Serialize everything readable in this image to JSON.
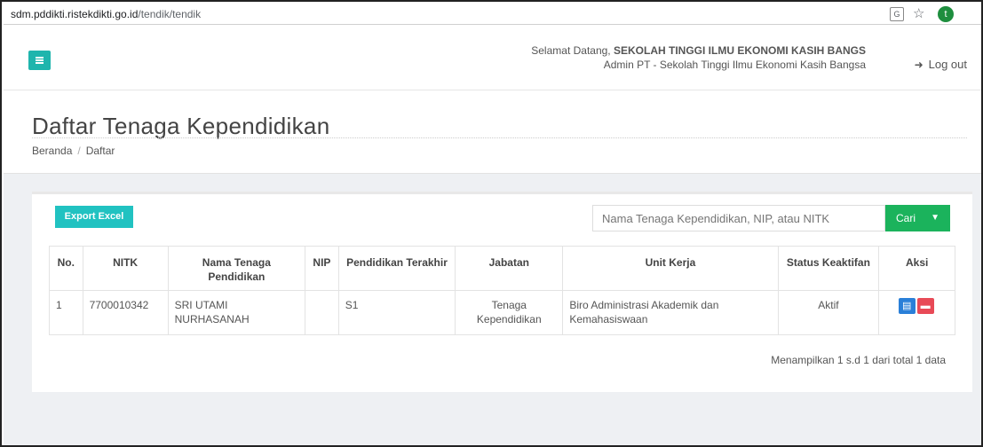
{
  "browser": {
    "url_host": "sdm.pddikti.ristekdikti.go.id",
    "url_path": "/tendik/tendik",
    "profile_initial": "t"
  },
  "header": {
    "welcome_prefix": "Selamat Datang,",
    "institution": "SEKOLAH TINGGI ILMU EKONOMI KASIH BANGS",
    "role": "Admin PT - Sekolah Tinggi Ilmu Ekonomi Kasih Bangsa",
    "logout_label": "Log out"
  },
  "page": {
    "title": "Daftar Tenaga Kependidikan",
    "breadcrumb": [
      "Beranda",
      "Daftar"
    ]
  },
  "toolbar": {
    "export_label": "Export Excel",
    "search_placeholder": "Nama Tenaga Kependidikan, NIP, atau NITK",
    "search_label": "Cari"
  },
  "table": {
    "headers": [
      "No.",
      "NITK",
      "Nama Tenaga Pendidikan",
      "NIP",
      "Pendidikan Terakhir",
      "Jabatan",
      "Unit Kerja",
      "Status Keaktifan",
      "Aksi"
    ],
    "rows": [
      {
        "no": "1",
        "nitk": "7700010342",
        "nama": "SRI UTAMI NURHASANAH",
        "nip": "",
        "pendidikan": "S1",
        "jabatan": "Tenaga Kependidikan",
        "unit": "Biro Administrasi Akademik dan Kemahasiswaan",
        "status": "Aktif"
      }
    ]
  },
  "footer": {
    "info": "Menampilkan 1 s.d 1 dari total 1 data"
  },
  "colors": {
    "accent_teal": "#1fb5ad",
    "export_teal": "#21c2c1",
    "search_green": "#1bb35c",
    "detail_blue": "#2a7fd8",
    "delete_red": "#e84a57"
  }
}
